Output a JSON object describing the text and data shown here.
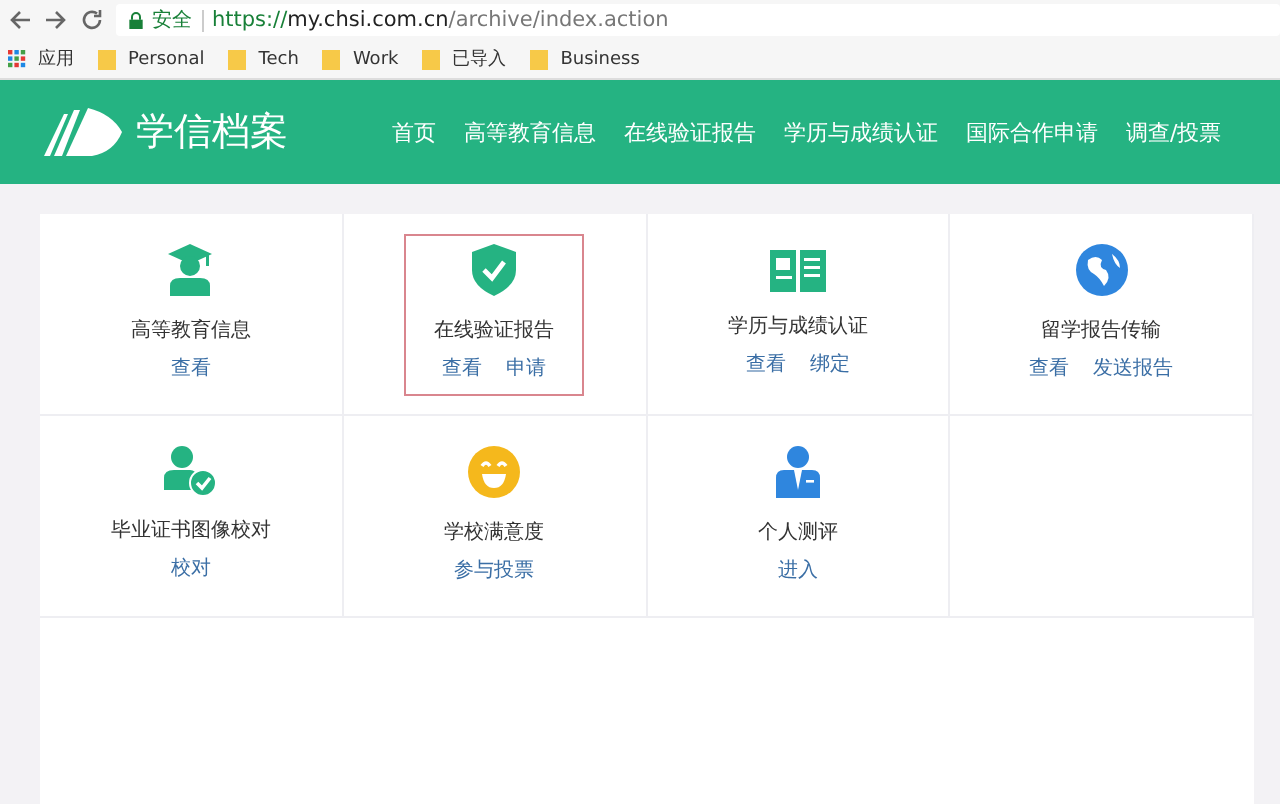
{
  "browser": {
    "security": "安全",
    "url": {
      "scheme": "https://",
      "host": "my.chsi.com.cn",
      "path": "/archive/index.action"
    },
    "bookmarks": [
      {
        "kind": "apps",
        "label": "应用"
      },
      {
        "kind": "folder",
        "label": "Personal"
      },
      {
        "kind": "folder",
        "label": "Tech"
      },
      {
        "kind": "folder",
        "label": "Work"
      },
      {
        "kind": "folder",
        "label": "已导入"
      },
      {
        "kind": "folder",
        "label": "Business"
      }
    ]
  },
  "header": {
    "logo": "学信档案",
    "nav": [
      "首页",
      "高等教育信息",
      "在线验证报告",
      "学历与成绩认证",
      "国际合作申请",
      "调查/投票"
    ]
  },
  "tiles": [
    {
      "kind": "graduate",
      "title": "高等教育信息",
      "links": [
        "查看"
      ],
      "highlighted": false
    },
    {
      "kind": "shield",
      "title": "在线验证报告",
      "links": [
        "查看",
        "申请"
      ],
      "highlighted": true
    },
    {
      "kind": "book",
      "title": "学历与成绩认证",
      "links": [
        "查看",
        "绑定"
      ],
      "highlighted": false
    },
    {
      "kind": "globe",
      "title": "留学报告传输",
      "links": [
        "查看",
        "发送报告"
      ],
      "highlighted": false
    },
    {
      "kind": "usercheck",
      "title": "毕业证书图像校对",
      "links": [
        "校对"
      ],
      "highlighted": false
    },
    {
      "kind": "smile",
      "title": "学校满意度",
      "links": [
        "参与投票"
      ],
      "highlighted": false
    },
    {
      "kind": "person",
      "title": "个人测评",
      "links": [
        "进入"
      ],
      "highlighted": false
    },
    {
      "kind": "empty"
    }
  ]
}
